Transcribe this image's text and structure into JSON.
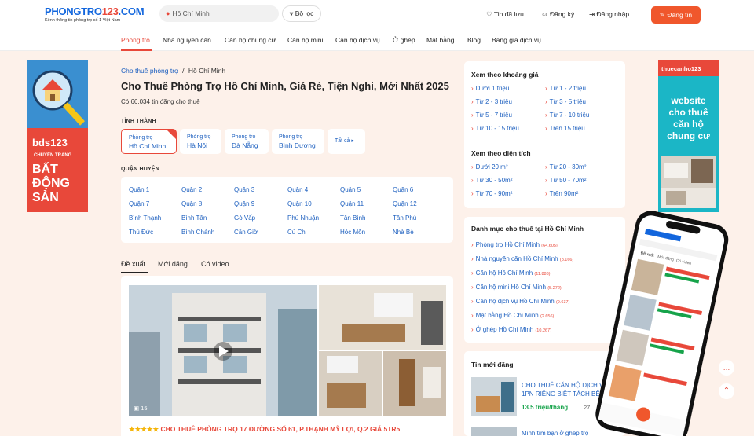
{
  "header": {
    "logo_blue1": "PHONGTRO",
    "logo_red": "123",
    "logo_blue2": ".COM",
    "tagline": "Kênh thông tin phòng trọ số 1 Việt Nam",
    "location": "Hồ Chí Minh",
    "filter": "Bộ lọc",
    "saved": "Tin đã lưu",
    "register": "Đăng ký",
    "login": "Đăng nhập",
    "post": "Đăng tin"
  },
  "nav": [
    "Phòng trọ",
    "Nhà nguyên căn",
    "Căn hộ chung cư",
    "Căn hộ mini",
    "Căn hộ dịch vụ",
    "Ở ghép",
    "Mặt bằng",
    "Blog",
    "Bảng giá dịch vụ"
  ],
  "banner_left": {
    "brand": "bds123",
    "tag": "CHUYÊN TRANG",
    "line1": "BẤT",
    "line2": "ĐỘNG",
    "line3": "SẢN"
  },
  "banner_right": {
    "brand": "thuecanho123",
    "l1": "website",
    "l2": "cho thuê",
    "l3": "căn hộ",
    "l4": "chung cư"
  },
  "breadcrumb": {
    "root": "Cho thuê phòng trọ",
    "sep": "/",
    "current": "Hồ Chí Minh"
  },
  "title": "Cho Thuê Phòng Trọ Hồ Chí Minh, Giá Rẻ, Tiện Nghi, Mới Nhất 2025",
  "count": "Có 66.034 tin đăng cho thuê",
  "province_label": "TỈNH THÀNH",
  "cities": [
    {
      "pre": "Phòng trọ",
      "name": "Hồ Chí Minh"
    },
    {
      "pre": "Phòng trọ",
      "name": "Hà Nội"
    },
    {
      "pre": "Phòng trọ",
      "name": "Đà Nẵng"
    },
    {
      "pre": "Phòng trọ",
      "name": "Bình Dương"
    }
  ],
  "all_label": "Tất cả",
  "district_label": "QUẬN HUYỆN",
  "districts": [
    "Quận 1",
    "Quận 2",
    "Quận 3",
    "Quận 4",
    "Quận 5",
    "Quận 6",
    "Quận 7",
    "Quận 8",
    "Quận 9",
    "Quận 10",
    "Quận 11",
    "Quận 12",
    "Bình Thạnh",
    "Bình Tân",
    "Gò Vấp",
    "Phú Nhuận",
    "Tân Bình",
    "Tân Phú",
    "Thủ Đức",
    "Bình Chánh",
    "Cần Giờ",
    "Củ Chi",
    "Hóc Môn",
    "Nhà Bè"
  ],
  "tabs": [
    "Đề xuất",
    "Mới đăng",
    "Có video"
  ],
  "listing": {
    "photo_count": "15",
    "stars": "★★★★★",
    "title": "CHO THUÊ PHÒNG TRỌ 17 ĐƯỜNG SỐ 61, P.THẠNH MỸ LỢI, Q.2 GIÁ 5TR5"
  },
  "price_box": {
    "title": "Xem theo khoảng giá",
    "items": [
      "Dưới 1 triệu",
      "Từ 1 - 2 triệu",
      "Từ 2 - 3 triệu",
      "Từ 3 - 5 triệu",
      "Từ 5 - 7 triệu",
      "Từ 7 - 10 triệu",
      "Từ 10 - 15 triệu",
      "Trên 15 triệu"
    ]
  },
  "area_box": {
    "title": "Xem theo diện tích",
    "items": [
      "Dưới 20 m²",
      "Từ 20 - 30m²",
      "Từ 30 - 50m²",
      "Từ 50 - 70m²",
      "Từ 70 - 90m²",
      "Trên 90m²"
    ]
  },
  "cat_box": {
    "title": "Danh mục cho thuê tại Hồ Chí Minh",
    "items": [
      {
        "name": "Phòng trọ Hồ Chí Minh",
        "count": "(64.605)"
      },
      {
        "name": "Nhà nguyên căn Hồ Chí Minh",
        "count": "(8.166)"
      },
      {
        "name": "Căn hộ Hồ Chí Minh",
        "count": "(11.886)"
      },
      {
        "name": "Căn hộ mini Hồ Chí Minh",
        "count": "(5.272)"
      },
      {
        "name": "Căn hộ dịch vụ Hồ Chí Minh",
        "count": "(9.637)"
      },
      {
        "name": "Mặt bằng Hồ Chí Minh",
        "count": "(2.656)"
      },
      {
        "name": "Ở ghép Hồ Chí Minh",
        "count": "(10.267)"
      }
    ]
  },
  "new_box": {
    "title": "Tin mới đăng",
    "item1_title": "CHO THUÊ CĂN HỘ DỊCH VỤ 1PN RIÊNG BIỆT TÁCH BẾP",
    "item1_price": "13.5 triệu/tháng",
    "item1_time": "27",
    "item2_title": "Minh tìm bạn ở ghép trọ"
  },
  "phone": {
    "tab1": "Đề xuất",
    "tab2": "Mới đăng",
    "tab3": "Có video"
  },
  "colors": {
    "accent": "#e8483a",
    "link": "#1c5fbf",
    "bg": "#fdf1ea",
    "post_btn": "#f0572c"
  }
}
